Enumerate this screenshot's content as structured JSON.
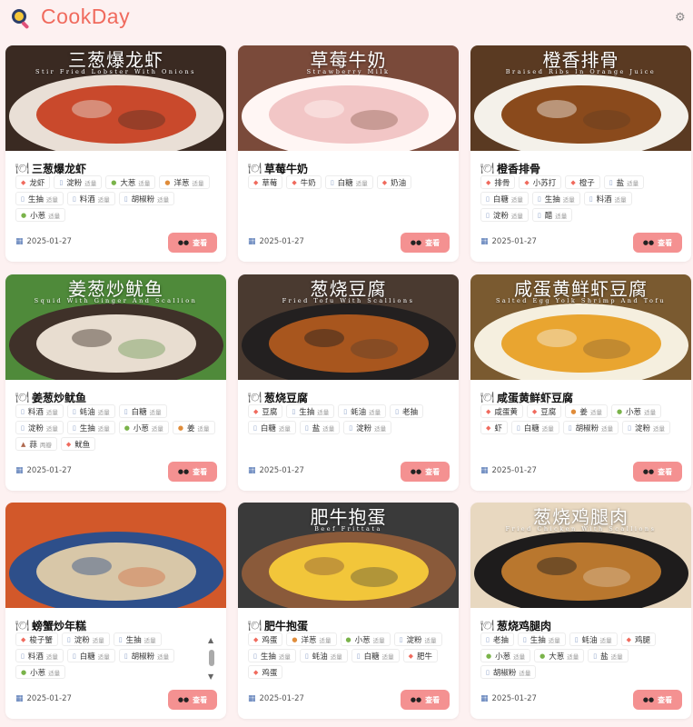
{
  "app": {
    "name": "CookDay",
    "logo_icon": "magnifier-logo-icon",
    "settings_icon": "gear-icon"
  },
  "view_label": "查看",
  "cards": [
    {
      "photo_title": "三葱爆龙虾",
      "photo_sub": "Stir Fried Lobster With Onions",
      "name": "三葱爆龙虾",
      "date": "2025-01-27",
      "photo_colors": [
        "#c9492c",
        "#e9dfd6",
        "#3a2a22"
      ],
      "ingredients": [
        {
          "name": "龙虾",
          "amount": "",
          "icon": "dot"
        },
        {
          "name": "淀粉",
          "amount": "适量",
          "icon": "bottle"
        },
        {
          "name": "大葱",
          "amount": "适量",
          "icon": "onion"
        },
        {
          "name": "洋葱",
          "amount": "适量",
          "icon": "ginger"
        },
        {
          "name": "生抽",
          "amount": "适量",
          "icon": "bottle"
        },
        {
          "name": "料酒",
          "amount": "适量",
          "icon": "bottle"
        },
        {
          "name": "胡椒粉",
          "amount": "适量",
          "icon": "bottle"
        },
        {
          "name": "小葱",
          "amount": "适量",
          "icon": "onion"
        }
      ]
    },
    {
      "photo_title": "草莓牛奶",
      "photo_sub": "Strawberry Milk",
      "name": "草莓牛奶",
      "date": "2025-01-27",
      "photo_colors": [
        "#f2c6c6",
        "#fff6f4",
        "#7a4a3a"
      ],
      "ingredients": [
        {
          "name": "草莓",
          "amount": "",
          "icon": "dot"
        },
        {
          "name": "牛奶",
          "amount": "",
          "icon": "dot"
        },
        {
          "name": "白糖",
          "amount": "适量",
          "icon": "bottle"
        },
        {
          "name": "奶油",
          "amount": "",
          "icon": "dot"
        }
      ]
    },
    {
      "photo_title": "橙香排骨",
      "photo_sub": "Braised Ribs In Orange Juice",
      "name": "橙香排骨",
      "date": "2025-01-27",
      "photo_colors": [
        "#8a4a1c",
        "#f4f1ea",
        "#5a3a22"
      ],
      "ingredients": [
        {
          "name": "排骨",
          "amount": "",
          "icon": "dot"
        },
        {
          "name": "小苏打",
          "amount": "",
          "icon": "dot"
        },
        {
          "name": "橙子",
          "amount": "",
          "icon": "dot"
        },
        {
          "name": "盐",
          "amount": "适量",
          "icon": "bottle"
        },
        {
          "name": "白糖",
          "amount": "适量",
          "icon": "bottle"
        },
        {
          "name": "生抽",
          "amount": "适量",
          "icon": "bottle"
        },
        {
          "name": "料酒",
          "amount": "适量",
          "icon": "bottle"
        },
        {
          "name": "淀粉",
          "amount": "适量",
          "icon": "bottle"
        },
        {
          "name": "醋",
          "amount": "适量",
          "icon": "bottle"
        }
      ]
    },
    {
      "photo_title": "姜葱炒鱿鱼",
      "photo_sub": "Squid With Ginger And Scallion",
      "name": "姜葱炒鱿鱼",
      "date": "2025-01-27",
      "photo_colors": [
        "#e8ddd0",
        "#3f3129",
        "#4f8a3a"
      ],
      "ingredients": [
        {
          "name": "料酒",
          "amount": "适量",
          "icon": "bottle"
        },
        {
          "name": "蚝油",
          "amount": "适量",
          "icon": "bottle"
        },
        {
          "name": "白糖",
          "amount": "适量",
          "icon": "bottle"
        },
        {
          "name": "淀粉",
          "amount": "适量",
          "icon": "bottle"
        },
        {
          "name": "生抽",
          "amount": "适量",
          "icon": "bottle"
        },
        {
          "name": "小葱",
          "amount": "适量",
          "icon": "onion"
        },
        {
          "name": "姜",
          "amount": "适量",
          "icon": "ginger"
        },
        {
          "name": "蒜",
          "amount": "两瓣",
          "icon": "garlic"
        },
        {
          "name": "鱿鱼",
          "amount": "",
          "icon": "dot"
        }
      ]
    },
    {
      "photo_title": "葱烧豆腐",
      "photo_sub": "Fried Tofu With Scallions",
      "name": "葱烧豆腐",
      "date": "2025-01-27",
      "photo_colors": [
        "#a8561e",
        "#232020",
        "#4a3a30"
      ],
      "ingredients": [
        {
          "name": "豆腐",
          "amount": "",
          "icon": "dot"
        },
        {
          "name": "生抽",
          "amount": "适量",
          "icon": "bottle"
        },
        {
          "name": "蚝油",
          "amount": "适量",
          "icon": "bottle"
        },
        {
          "name": "老抽",
          "amount": "",
          "icon": "bottle"
        },
        {
          "name": "白糖",
          "amount": "适量",
          "icon": "bottle"
        },
        {
          "name": "盐",
          "amount": "适量",
          "icon": "bottle"
        },
        {
          "name": "淀粉",
          "amount": "适量",
          "icon": "bottle"
        }
      ]
    },
    {
      "photo_title": "咸蛋黄鲜虾豆腐",
      "photo_sub": "Salted Egg Yolk Shrimp And Tofu",
      "name": "咸蛋黄鲜虾豆腐",
      "date": "2025-01-27",
      "photo_colors": [
        "#e9a530",
        "#f5efdf",
        "#7a5a30"
      ],
      "ingredients": [
        {
          "name": "咸蛋黄",
          "amount": "",
          "icon": "dot"
        },
        {
          "name": "豆腐",
          "amount": "",
          "icon": "dot"
        },
        {
          "name": "姜",
          "amount": "适量",
          "icon": "ginger"
        },
        {
          "name": "小葱",
          "amount": "适量",
          "icon": "onion"
        },
        {
          "name": "虾",
          "amount": "",
          "icon": "dot"
        },
        {
          "name": "白糖",
          "amount": "适量",
          "icon": "bottle"
        },
        {
          "name": "胡椒粉",
          "amount": "适量",
          "icon": "bottle"
        },
        {
          "name": "淀粉",
          "amount": "适量",
          "icon": "bottle"
        }
      ]
    },
    {
      "photo_title": "",
      "photo_sub": "",
      "name": "螃蟹炒年糕",
      "date": "2025-01-27",
      "photo_colors": [
        "#d8c7a8",
        "#2e4f8a",
        "#d2582a"
      ],
      "ingredients": [
        {
          "name": "梭子蟹",
          "amount": "",
          "icon": "dot"
        },
        {
          "name": "淀粉",
          "amount": "适量",
          "icon": "bottle"
        },
        {
          "name": "生抽",
          "amount": "适量",
          "icon": "bottle"
        },
        {
          "name": "料酒",
          "amount": "适量",
          "icon": "bottle"
        },
        {
          "name": "白糖",
          "amount": "适量",
          "icon": "bottle"
        },
        {
          "name": "胡椒粉",
          "amount": "适量",
          "icon": "bottle"
        },
        {
          "name": "小葱",
          "amount": "适量",
          "icon": "onion"
        }
      ]
    },
    {
      "photo_title": "肥牛抱蛋",
      "photo_sub": "Beef Frittata",
      "name": "肥牛抱蛋",
      "date": "2025-01-27",
      "photo_colors": [
        "#f2c63a",
        "#8a5a3a",
        "#3a3a3a"
      ],
      "ingredients": [
        {
          "name": "鸡蛋",
          "amount": "",
          "icon": "dot"
        },
        {
          "name": "洋葱",
          "amount": "适量",
          "icon": "ginger"
        },
        {
          "name": "小葱",
          "amount": "适量",
          "icon": "onion"
        },
        {
          "name": "淀粉",
          "amount": "适量",
          "icon": "bottle"
        },
        {
          "name": "生抽",
          "amount": "适量",
          "icon": "bottle"
        },
        {
          "name": "蚝油",
          "amount": "适量",
          "icon": "bottle"
        },
        {
          "name": "白糖",
          "amount": "适量",
          "icon": "bottle"
        },
        {
          "name": "肥牛",
          "amount": "",
          "icon": "dot"
        },
        {
          "name": "鸡蛋",
          "amount": "",
          "icon": "dot"
        }
      ]
    },
    {
      "photo_title": "葱烧鸡腿肉",
      "photo_sub": "Fried Chicken With Scallions",
      "name": "葱烧鸡腿肉",
      "date": "2025-01-27",
      "photo_colors": [
        "#b9772e",
        "#1e1c1c",
        "#e8d8c0"
      ],
      "ingredients": [
        {
          "name": "老抽",
          "amount": "",
          "icon": "bottle"
        },
        {
          "name": "生抽",
          "amount": "适量",
          "icon": "bottle"
        },
        {
          "name": "蚝油",
          "amount": "适量",
          "icon": "bottle"
        },
        {
          "name": "鸡腿",
          "amount": "",
          "icon": "dot"
        },
        {
          "name": "小葱",
          "amount": "适量",
          "icon": "onion"
        },
        {
          "name": "大葱",
          "amount": "适量",
          "icon": "onion"
        },
        {
          "name": "盐",
          "amount": "适量",
          "icon": "bottle"
        },
        {
          "name": "胡椒粉",
          "amount": "适量",
          "icon": "bottle"
        }
      ]
    }
  ]
}
